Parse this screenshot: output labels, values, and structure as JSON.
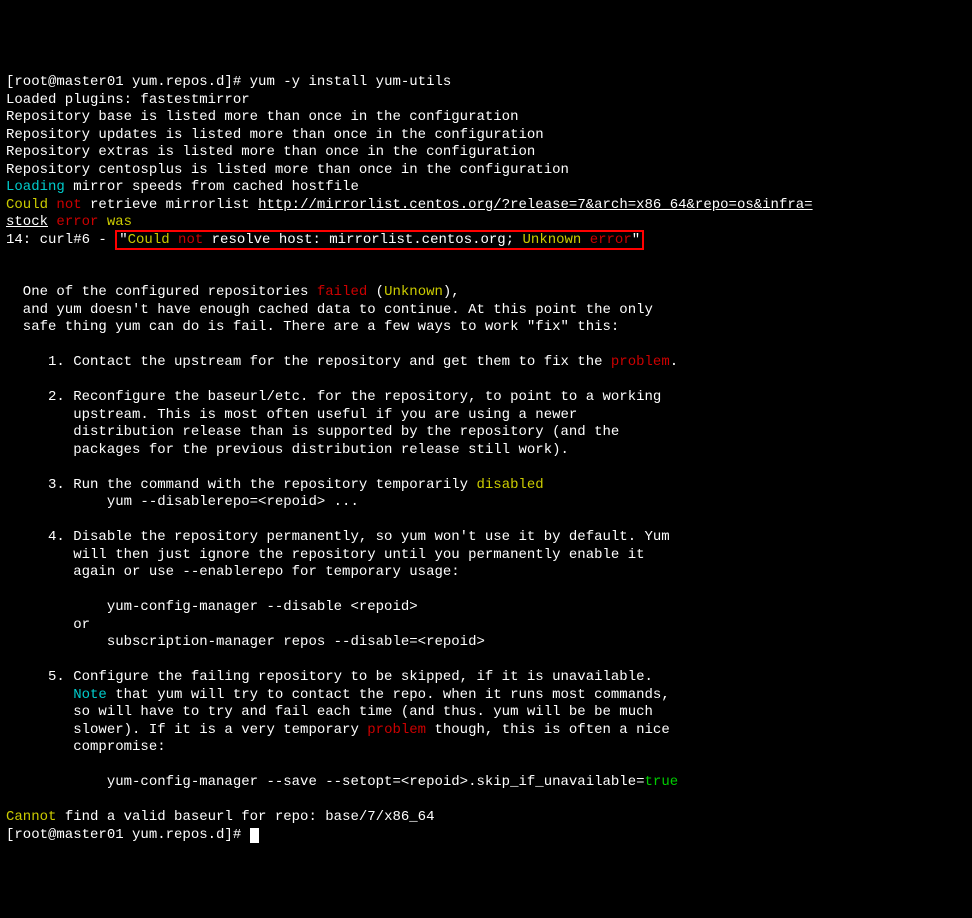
{
  "prompt1": "[root@master01 yum.repos.d]# ",
  "command1": "yum -y install yum-utils",
  "line_plugins": "Loaded plugins: fastestmirror",
  "repo_base": "Repository base is listed more than once in the configuration",
  "repo_updates": "Repository updates is listed more than once in the configuration",
  "repo_extras": "Repository extras is listed more than once in the configuration",
  "repo_centosplus": "Repository centosplus is listed more than once in the configuration",
  "loading_word": "Loading",
  "loading_rest": " mirror speeds from cached hostfile",
  "could": "Could",
  "not": " not",
  "retrieve": " retrieve mirrorlist ",
  "url": "http://mirrorlist.centos.org/?release=7&arch=x86_64&repo=os&infra=",
  "stock": "stock",
  "error_word": " error",
  "was": " was",
  "e14_prefix": "14: curl#6 - ",
  "q1": "\"",
  "hl_could": "Could",
  "hl_not": " not",
  "hl_resolve": " resolve host: mirrorlist.centos.org; ",
  "hl_unknown": "Unknown",
  "hl_error": " error",
  "q2": "\"",
  "blank": " ",
  "para1_a": "  One of the configured repositories ",
  "failed_word": "failed",
  "para1_b": " (",
  "unknown_word": "Unknown",
  "para1_c": "),",
  "para2": "  and yum doesn't have enough cached data to continue. At this point the only",
  "para3": "  safe thing yum can do is fail. There are a few ways to work \"fix\" this:",
  "s1a": "     1. Contact the upstream for the repository and get them to fix the ",
  "problem1": "problem",
  "s1b": ".",
  "s2a": "     2. Reconfigure the baseurl/etc. for the repository, to point to a working",
  "s2b": "        upstream. This is most often useful if you are using a newer",
  "s2c": "        distribution release than is supported by the repository (and the",
  "s2d": "        packages for the previous distribution release still work).",
  "s3a": "     3. Run the command with the repository temporarily ",
  "disabled_word": "disabled",
  "s3b": "            yum --disablerepo=<repoid> ...",
  "s4a": "     4. Disable the repository permanently, so yum won't use it by default. Yum",
  "s4b": "        will then just ignore the repository until you permanently enable it",
  "s4c": "        again or use --enablerepo for temporary usage:",
  "s4d": "            yum-config-manager --disable <repoid>",
  "s4e": "        or",
  "s4f": "            subscription-manager repos --disable=<repoid>",
  "s5a": "     5. Configure the failing repository to be skipped, if it is unavailable.",
  "s5b_pre": "        ",
  "note_word": "Note",
  "s5b_post": " that yum will try to contact the repo. when it runs most commands,",
  "s5c": "        so will have to try and fail each time (and thus. yum will be be much",
  "s5d_pre": "        slower). If it is a very temporary ",
  "problem2": "problem",
  "s5d_post": " though, this is often a nice",
  "s5e": "        compromise:",
  "s5f_pre": "            yum-config-manager --save --setopt=<repoid>.skip_if_unavailable=",
  "true_word": "true",
  "cannot_word": "Cannot",
  "cannot_rest": " find a valid baseurl for repo: base/7/x86_64",
  "prompt2": "[root@master01 yum.repos.d]# "
}
